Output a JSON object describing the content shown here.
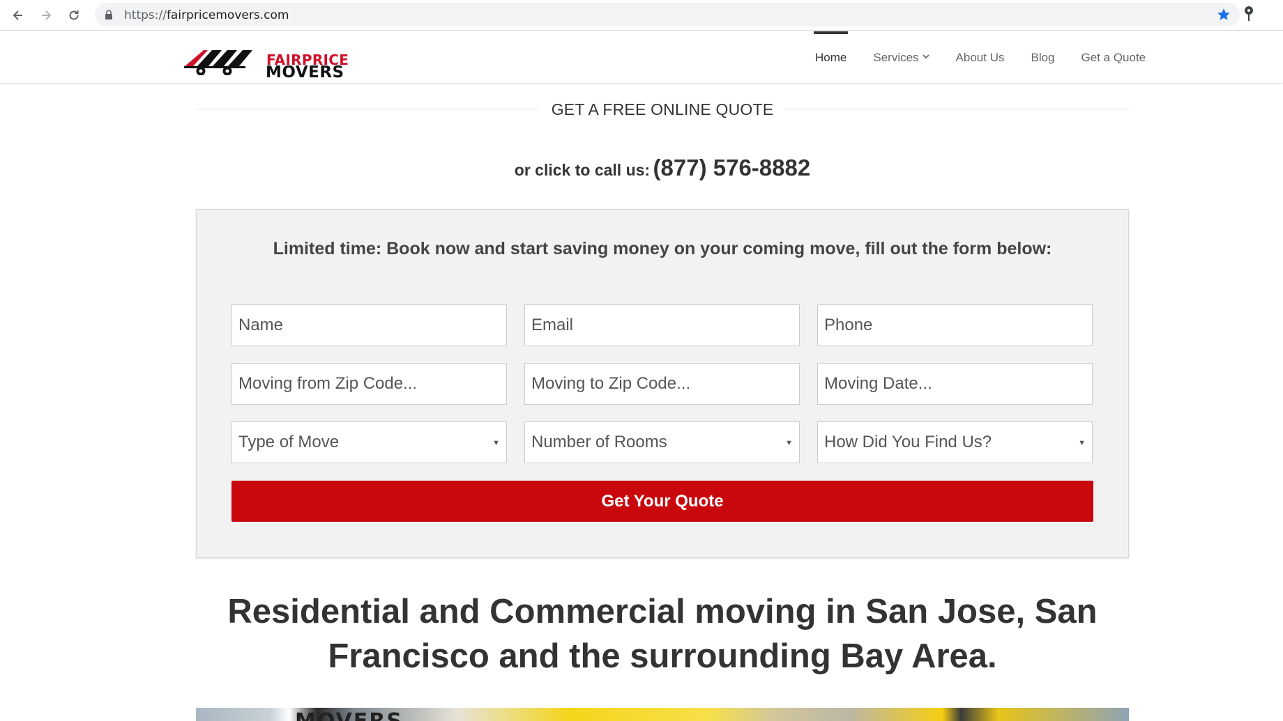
{
  "browser": {
    "url_scheme": "https://",
    "url_host": "fairpricemovers.com"
  },
  "logo": {
    "line1": "FAIRPRICE",
    "line2": "MOVERS"
  },
  "nav": {
    "home": "Home",
    "services": "Services",
    "about": "About Us",
    "blog": "Blog",
    "quote": "Get a Quote"
  },
  "quote_section": {
    "title": "GET A FREE ONLINE QUOTE",
    "call_label": "or click to call us:",
    "phone": "(877) 576-8882",
    "headline": "Limited time: Book now and start saving money on your coming move, fill out the form below:"
  },
  "form": {
    "name_placeholder": "Name",
    "email_placeholder": "Email",
    "phone_placeholder": "Phone",
    "from_zip_placeholder": "Moving from Zip Code...",
    "to_zip_placeholder": "Moving to Zip Code...",
    "date_placeholder": "Moving Date...",
    "type_of_move": "Type of Move",
    "number_of_rooms": "Number of Rooms",
    "how_found": "How Did You Find Us?",
    "submit_label": "Get Your Quote"
  },
  "hero": {
    "text": "Residential and Commercial moving in San Jose, San Francisco and the surrounding Bay Area."
  },
  "photo": {
    "visible_text": "MOVERS"
  },
  "colors": {
    "brand_red": "#c8080c",
    "logo_red": "#d0102a",
    "form_bg": "#f2f2f2",
    "star_blue": "#1a73e8"
  }
}
